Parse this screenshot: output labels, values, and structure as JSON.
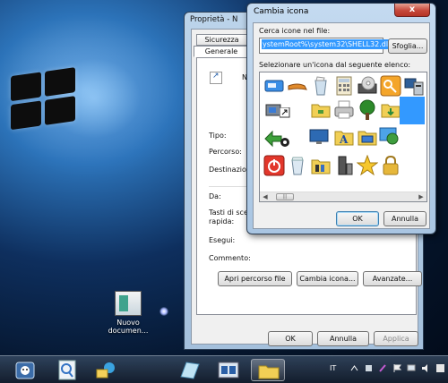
{
  "desktop": {
    "icon_label": "Nuovo documen..."
  },
  "properties_window": {
    "title": "Proprietà - N",
    "tabs": [
      "Sicurezza",
      "Generale"
    ],
    "shortcut_name": "N",
    "fields": {
      "tipo": "Tipo:",
      "percorso": "Percorso:",
      "destinazione": "Destinazione:",
      "da": "Da:",
      "tasti": "Tasti di scelta rapida:",
      "esegui": "Esegui:",
      "commento": "Commento:"
    },
    "buttons": {
      "apri": "Apri percorso file",
      "cambia": "Cambia icona...",
      "avanzate": "Avanzate...",
      "ok": "OK",
      "annulla": "Annulla",
      "applica": "Applica"
    }
  },
  "change_icon_dialog": {
    "title": "Cambia icona",
    "close_label": "x",
    "search_label": "Cerca icone nel file:",
    "path_value": "ystemRoot%\\system32\\SHELL32.dll",
    "browse_label": "Sfoglia...",
    "select_label": "Selezionare un'icona dal seguente elenco:",
    "ok_label": "OK",
    "cancel_label": "Annulla",
    "scroll_thumb": "|||",
    "icons": [
      {
        "name": "card-reader-icon"
      },
      {
        "name": "pipe-icon"
      },
      {
        "name": "recycle-bin-full-icon"
      },
      {
        "name": "calculator-icon"
      },
      {
        "name": "dvd-drive-icon"
      },
      {
        "name": "key-icon"
      },
      {
        "name": "network-computer-icon"
      },
      {
        "name": "printer-server-icon"
      },
      {
        "name": "shortcut-arrow-icon"
      },
      {
        "name": "folder-network-icon"
      },
      {
        "name": "printer-icon"
      },
      {
        "name": "tree-icon"
      },
      {
        "name": "folder-download-icon"
      },
      {
        "name": "blank-selected-icon"
      },
      {
        "name": "back-arrow-icon"
      },
      {
        "name": "monitor-icon"
      },
      {
        "name": "font-folder-icon"
      },
      {
        "name": "desktop-folder-icon"
      },
      {
        "name": "globe-icon"
      },
      {
        "name": "power-icon"
      },
      {
        "name": "recycle-bin-empty-icon"
      },
      {
        "name": "control-panel-folder-icon"
      },
      {
        "name": "server-icon"
      },
      {
        "name": "star-icon"
      },
      {
        "name": "lock-icon"
      }
    ]
  },
  "taskbar": {
    "language": "IT"
  }
}
